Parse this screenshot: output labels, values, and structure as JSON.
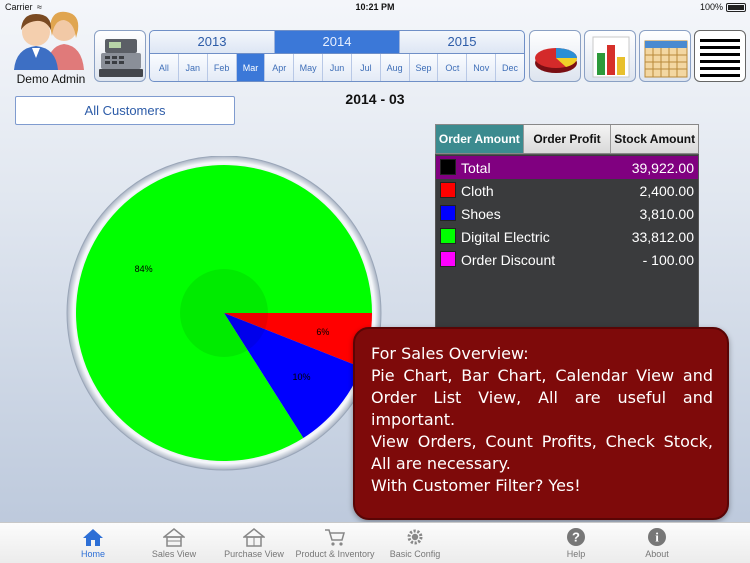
{
  "status_bar": {
    "carrier": "Carrier",
    "time": "10:21 PM",
    "battery": "100%"
  },
  "user": {
    "name": "Demo Admin"
  },
  "toolbar": {
    "icons": [
      "cash-register-icon",
      "pie-chart-icon",
      "bar-chart-icon",
      "calendar-icon",
      "list-icon"
    ]
  },
  "period_selector": {
    "years": [
      "2013",
      "2014",
      "2015"
    ],
    "selected_year": "2014",
    "months": [
      "All",
      "Jan",
      "Feb",
      "Mar",
      "Apr",
      "May",
      "Jun",
      "Jul",
      "Aug",
      "Sep",
      "Oct",
      "Nov",
      "Dec"
    ],
    "selected_month": "Mar"
  },
  "customer_filter": {
    "label": "All Customers"
  },
  "period_title": "2014 - 03",
  "chart_data": {
    "type": "pie",
    "slices": [
      {
        "label": "84%",
        "category": "Digital Electric",
        "value": 84,
        "color": "#00ff00"
      },
      {
        "label": "6%",
        "category": "Cloth",
        "value": 6,
        "color": "#ff0000"
      },
      {
        "label": "10%",
        "category": "Shoes",
        "value": 10,
        "color": "#0000ff"
      }
    ]
  },
  "amount_tabs": {
    "items": [
      "Order Amount",
      "Order Profit",
      "Stock Amount"
    ],
    "active": "Order Amount"
  },
  "summary_rows": [
    {
      "label": "Total",
      "value": "39,922.00",
      "color": "#000000"
    },
    {
      "label": "Cloth",
      "value": "2,400.00",
      "color": "#ff0000"
    },
    {
      "label": "Shoes",
      "value": "3,810.00",
      "color": "#0000ff"
    },
    {
      "label": "Digital Electric",
      "value": "33,812.00",
      "color": "#00ff00"
    },
    {
      "label": "Order Discount",
      "value": "- 100.00",
      "color": "#ff00ff"
    }
  ],
  "callout": {
    "lines": [
      "For Sales Overview:",
      "Pie Chart, Bar Chart, Calendar View and Order List View, All are useful and important.",
      "View Orders, Count Profits, Check Stock, All are necessary.",
      "With Customer Filter? Yes!"
    ]
  },
  "tab_bar": {
    "items": [
      {
        "label": "Home",
        "icon": "home-icon",
        "active": true
      },
      {
        "label": "Sales View",
        "icon": "sales-view-icon",
        "active": false
      },
      {
        "label": "Purchase View",
        "icon": "purchase-view-icon",
        "active": false
      },
      {
        "label": "Product & Inventory",
        "icon": "cart-icon",
        "active": false
      },
      {
        "label": "Basic Config",
        "icon": "gear-icon",
        "active": false
      },
      {
        "label": "Help",
        "icon": "help-icon",
        "active": false
      },
      {
        "label": "About",
        "icon": "info-icon",
        "active": false
      }
    ]
  }
}
